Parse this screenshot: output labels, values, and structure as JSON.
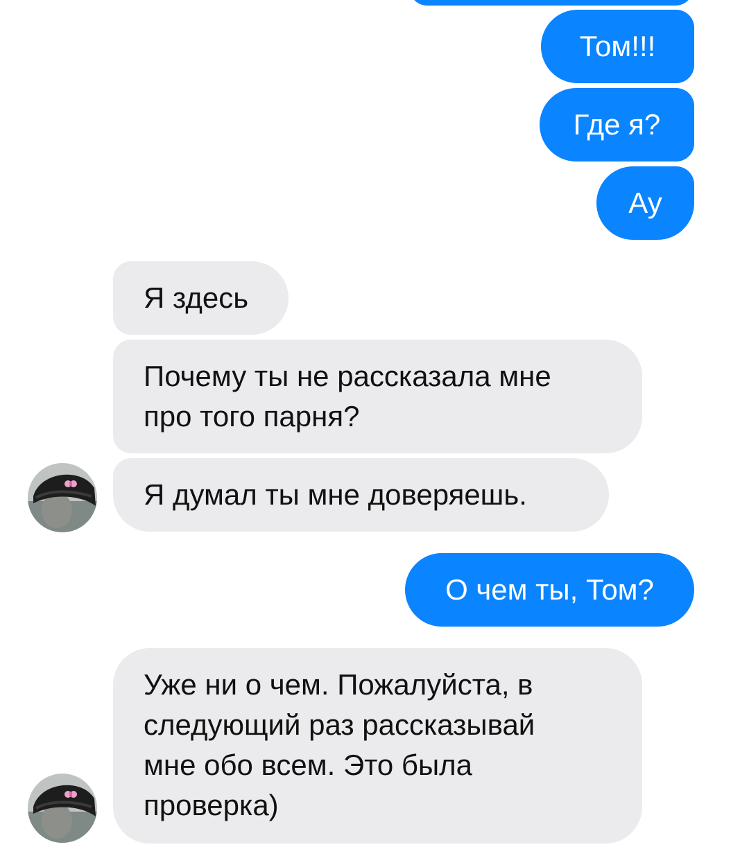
{
  "colors": {
    "outgoing_bubble": "#0a84ff",
    "incoming_bubble": "#ebeaec",
    "outgoing_text": "#ffffff",
    "incoming_text": "#111111",
    "background": "#ffffff"
  },
  "messages": [
    {
      "direction": "outgoing",
      "text": "Том!!!"
    },
    {
      "direction": "outgoing",
      "text": "Где я?"
    },
    {
      "direction": "outgoing",
      "text": "Ау"
    },
    {
      "direction": "incoming",
      "text": "Я здесь"
    },
    {
      "direction": "incoming",
      "lines": [
        "Почему ты не рассказала мне",
        "про того парня?"
      ]
    },
    {
      "direction": "incoming",
      "text": "Я думал ты мне доверяешь.",
      "avatar": "contact-avatar"
    },
    {
      "direction": "outgoing",
      "text": "О чем ты, Том?"
    },
    {
      "direction": "incoming",
      "lines": [
        "Уже ни о чем. Пожалуйста, в",
        "следующий раз рассказывай",
        "мне обо всем. Это была",
        "проверка)"
      ],
      "avatar": "contact-avatar"
    }
  ]
}
